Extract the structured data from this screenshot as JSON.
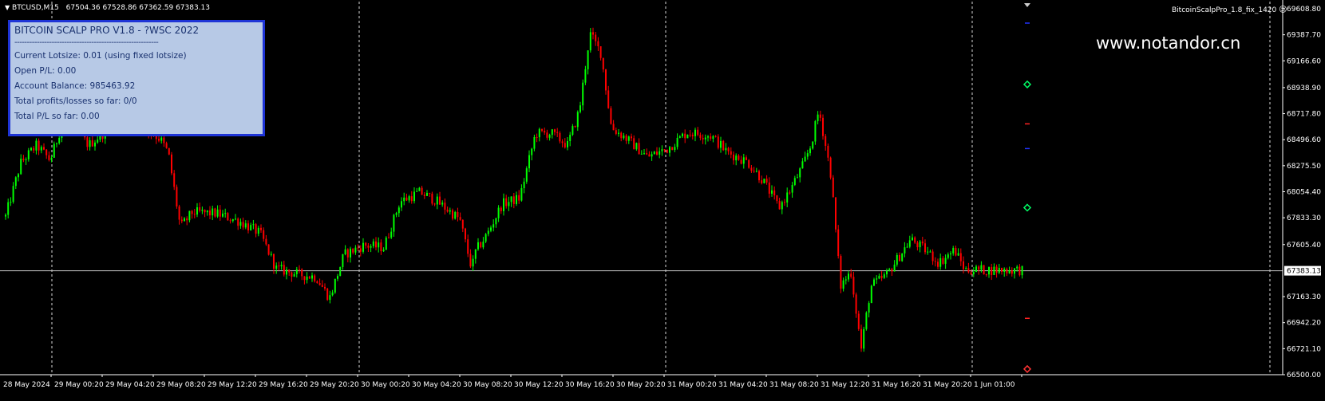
{
  "header": {
    "symbol": "BTCUSD,M15",
    "ohlc": "67504.36 67528.86 67362.59 67383.13"
  },
  "ea_label": "BitcoinScalpPro_1.8_fix_1420",
  "watermark": "www.notandor.cn",
  "panel": {
    "title": "BITCOIN SCALP PRO V1.8 - ?WSC 2022",
    "separator": "----------------------------------------------------------",
    "lines": [
      "Current Lotsize: 0.01 (using fixed lotsize)",
      "Open P/L: 0.00",
      "Account Balance: 985463.92",
      "Total profits/losses so far: 0/0",
      "Total P/L so far: 0.00"
    ]
  },
  "colors": {
    "bull": "#00ff00",
    "bear": "#ff0000",
    "grid": "#ffffff",
    "axis_text": "#ffffff",
    "current_price_line": "#c0c0c0",
    "panel_bg": "#b7c9e6",
    "panel_border": "#1e34d6"
  },
  "chart_data": {
    "type": "candlestick",
    "ylim": [
      66500.0,
      69608.8
    ],
    "y_ticks": [
      "69608.80",
      "69387.70",
      "69166.60",
      "68938.90",
      "68717.80",
      "68496.60",
      "68275.50",
      "68054.40",
      "67833.30",
      "67605.40",
      "67383.13",
      "67163.30",
      "66942.20",
      "66721.10",
      "66500.00"
    ],
    "current_price": 67383.13,
    "x_ticks": [
      "28 May 2024",
      "29 May 00:20",
      "29 May 04:20",
      "29 May 08:20",
      "29 May 12:20",
      "29 May 16:20",
      "29 May 20:20",
      "30 May 00:20",
      "30 May 04:20",
      "30 May 08:20",
      "30 May 12:20",
      "30 May 16:20",
      "30 May 20:20",
      "31 May 00:20",
      "31 May 04:20",
      "31 May 08:20",
      "31 May 12:20",
      "31 May 16:20",
      "31 May 20:20",
      "1 Jun 01:00"
    ],
    "grid": "vertical dashed",
    "price_path": [
      [
        0,
        67700
      ],
      [
        25,
        68300
      ],
      [
        45,
        68450
      ],
      [
        62,
        68320
      ],
      [
        80,
        68700
      ],
      [
        110,
        68450
      ],
      [
        140,
        68620
      ],
      [
        170,
        68650
      ],
      [
        200,
        68500
      ],
      [
        210,
        68380
      ],
      [
        225,
        67750
      ],
      [
        240,
        67880
      ],
      [
        270,
        67870
      ],
      [
        300,
        67800
      ],
      [
        325,
        67700
      ],
      [
        345,
        67400
      ],
      [
        375,
        67350
      ],
      [
        395,
        67330
      ],
      [
        412,
        67150
      ],
      [
        430,
        67520
      ],
      [
        455,
        67600
      ],
      [
        480,
        67580
      ],
      [
        500,
        67970
      ],
      [
        525,
        68050
      ],
      [
        545,
        67980
      ],
      [
        575,
        67820
      ],
      [
        590,
        67400
      ],
      [
        595,
        67550
      ],
      [
        610,
        67700
      ],
      [
        628,
        67950
      ],
      [
        650,
        68000
      ],
      [
        670,
        68550
      ],
      [
        690,
        68550
      ],
      [
        710,
        68450
      ],
      [
        725,
        68750
      ],
      [
        738,
        69400
      ],
      [
        752,
        69230
      ],
      [
        765,
        68600
      ],
      [
        785,
        68500
      ],
      [
        810,
        68350
      ],
      [
        835,
        68420
      ],
      [
        860,
        68560
      ],
      [
        890,
        68530
      ],
      [
        910,
        68390
      ],
      [
        935,
        68310
      ],
      [
        955,
        68150
      ],
      [
        975,
        67920
      ],
      [
        990,
        68080
      ],
      [
        1005,
        68280
      ],
      [
        1015,
        68450
      ],
      [
        1025,
        68750
      ],
      [
        1040,
        68200
      ],
      [
        1052,
        67250
      ],
      [
        1065,
        67380
      ],
      [
        1078,
        66720
      ],
      [
        1090,
        67250
      ],
      [
        1110,
        67350
      ],
      [
        1125,
        67500
      ],
      [
        1140,
        67650
      ],
      [
        1160,
        67550
      ],
      [
        1175,
        67450
      ],
      [
        1195,
        67560
      ],
      [
        1208,
        67390
      ]
    ],
    "markers": [
      {
        "type": "dash",
        "color": "#2233ff",
        "price": 69487
      },
      {
        "type": "diamond",
        "color": "#00ff66",
        "price": 68966
      },
      {
        "type": "dash",
        "color": "#ff2222",
        "price": 68631
      },
      {
        "type": "dash",
        "color": "#2233ff",
        "price": 68421
      },
      {
        "type": "diamond",
        "color": "#00ff66",
        "price": 67919
      },
      {
        "type": "dash",
        "color": "#ff2222",
        "price": 66979
      },
      {
        "type": "diamond",
        "color": "#ff3333",
        "price": 66548
      }
    ]
  }
}
